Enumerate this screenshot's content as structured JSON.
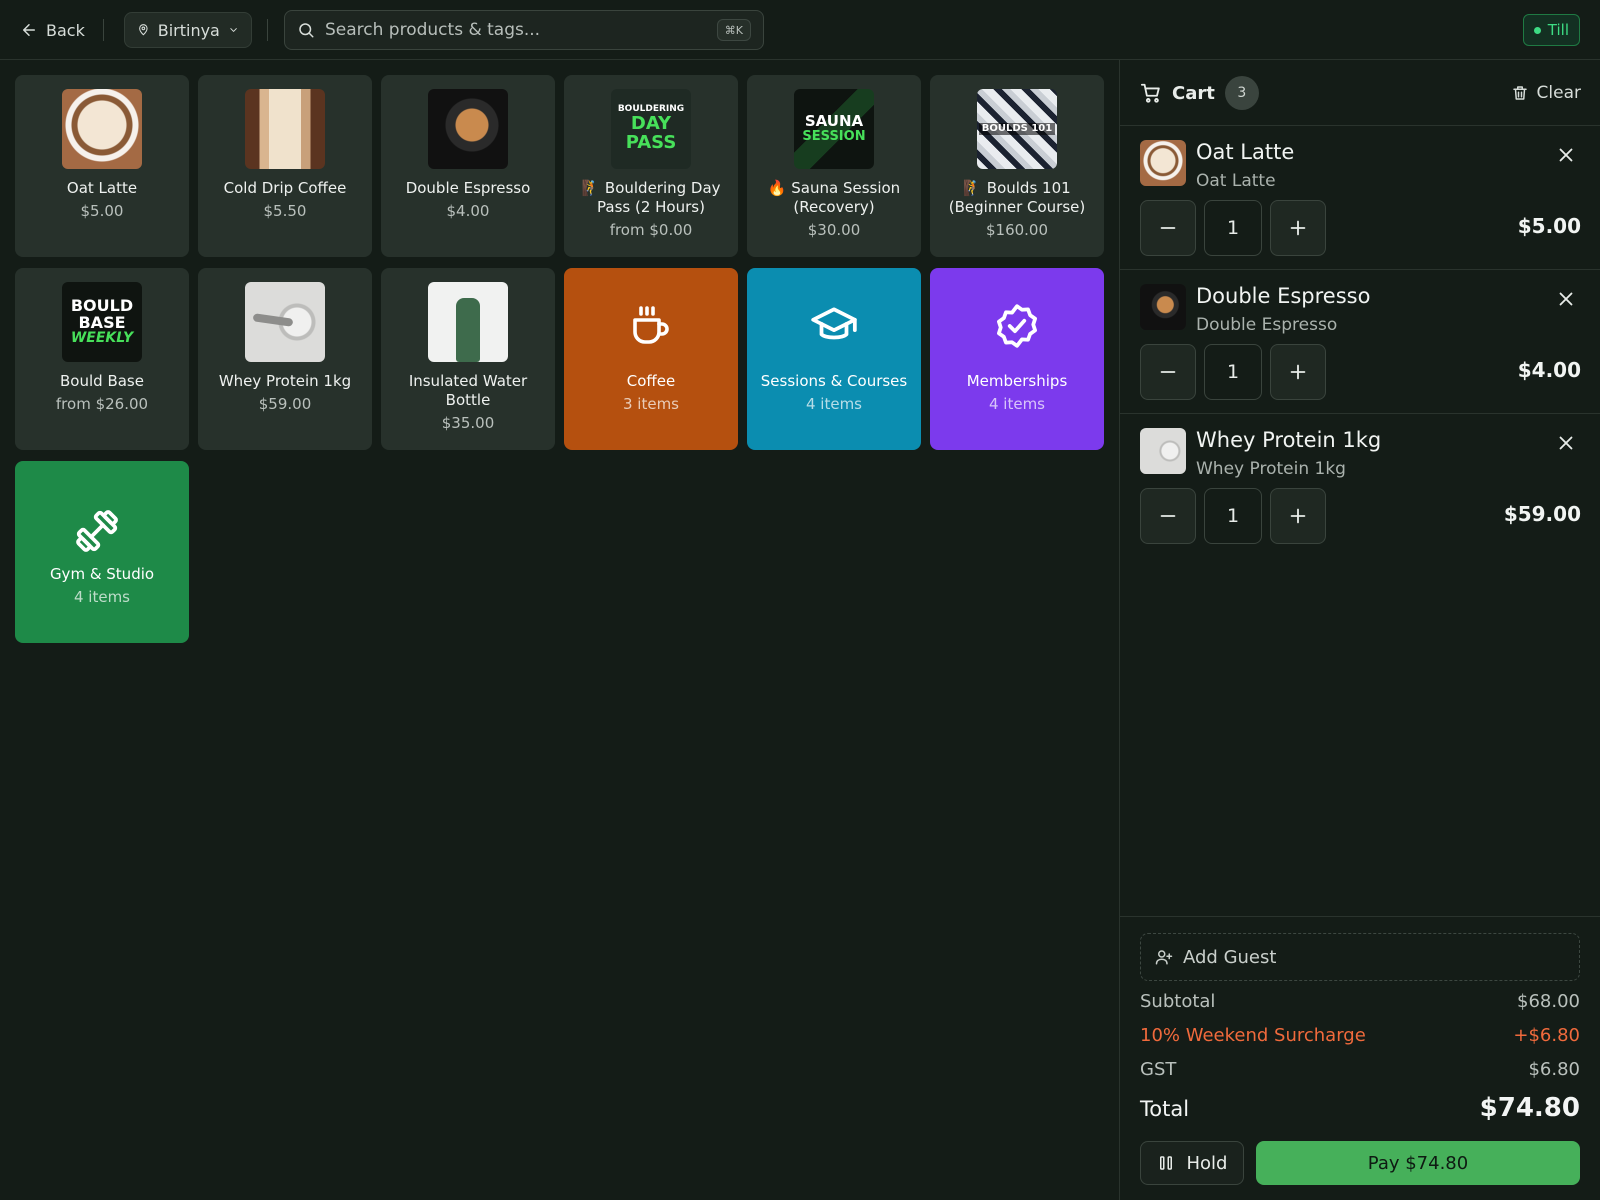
{
  "header": {
    "back_label": "Back",
    "location": "Birtinya",
    "search_placeholder": "Search products & tags...",
    "search_shortcut": "⌘K",
    "till_label": "Till"
  },
  "products": [
    {
      "name": "Oat Latte",
      "price": "$5.00",
      "prefix": "",
      "thumb": "latte"
    },
    {
      "name": "Cold Drip Coffee",
      "price": "$5.50",
      "prefix": "",
      "thumb": "colddrip"
    },
    {
      "name": "Double Espresso",
      "price": "$4.00",
      "prefix": "",
      "thumb": "espresso"
    },
    {
      "name": "Bouldering Day Pass (2 Hours)",
      "price": "from $0.00",
      "prefix": "🧗",
      "thumb": "daypass"
    },
    {
      "name": "Sauna Session (Recovery)",
      "price": "$30.00",
      "prefix": "🔥",
      "thumb": "sauna"
    },
    {
      "name": "Boulds 101 (Beginner Course)",
      "price": "$160.00",
      "prefix": "🧗",
      "thumb": "boulds101"
    },
    {
      "name": "Bould Base",
      "price": "from $26.00",
      "prefix": "",
      "thumb": "bouldbase"
    },
    {
      "name": "Whey Protein 1kg",
      "price": "$59.00",
      "prefix": "",
      "thumb": "whey"
    },
    {
      "name": "Insulated Water Bottle",
      "price": "$35.00",
      "prefix": "",
      "thumb": "bottle"
    }
  ],
  "thumb_text": {
    "daypass": [
      "BOULDERING",
      "DAY",
      "PASS"
    ],
    "sauna": [
      "SAUNA",
      "SESSION"
    ],
    "boulds101": [
      "BOULDS 101"
    ],
    "bouldbase": [
      "BOULD",
      "BASE",
      "WEEKLY"
    ]
  },
  "categories": [
    {
      "name": "Coffee",
      "count": "3 items",
      "color": "#b5500f",
      "icon": "coffee-cup-icon"
    },
    {
      "name": "Sessions & Courses",
      "count": "4 items",
      "color": "#0b8db0",
      "icon": "graduation-cap-icon"
    },
    {
      "name": "Memberships",
      "count": "4 items",
      "color": "#7c3aed",
      "icon": "badge-check-icon"
    },
    {
      "name": "Gym & Studio",
      "count": "4 items",
      "color": "#1e8a48",
      "icon": "dumbbell-icon"
    }
  ],
  "cart": {
    "title": "Cart",
    "count": "3",
    "clear_label": "Clear",
    "items": [
      {
        "name": "Oat Latte",
        "variant": "Oat Latte",
        "qty": "1",
        "price": "$5.00",
        "thumb": "latte"
      },
      {
        "name": "Double Espresso",
        "variant": "Double Espresso",
        "qty": "1",
        "price": "$4.00",
        "thumb": "espresso"
      },
      {
        "name": "Whey Protein 1kg",
        "variant": "Whey Protein 1kg",
        "qty": "1",
        "price": "$59.00",
        "thumb": "whey"
      }
    ],
    "add_guest_label": "Add Guest",
    "subtotal_label": "Subtotal",
    "subtotal": "$68.00",
    "surcharge_label": "10% Weekend Surcharge",
    "surcharge": "+$6.80",
    "gst_label": "GST",
    "gst": "$6.80",
    "total_label": "Total",
    "total": "$74.80",
    "hold_label": "Hold",
    "pay_label": "Pay $74.80"
  },
  "colors": {
    "background": "#141c17",
    "tile": "#27312b",
    "accent_green": "#46b05a",
    "surcharge": "#f06a3c",
    "till": "#3ddc84"
  }
}
